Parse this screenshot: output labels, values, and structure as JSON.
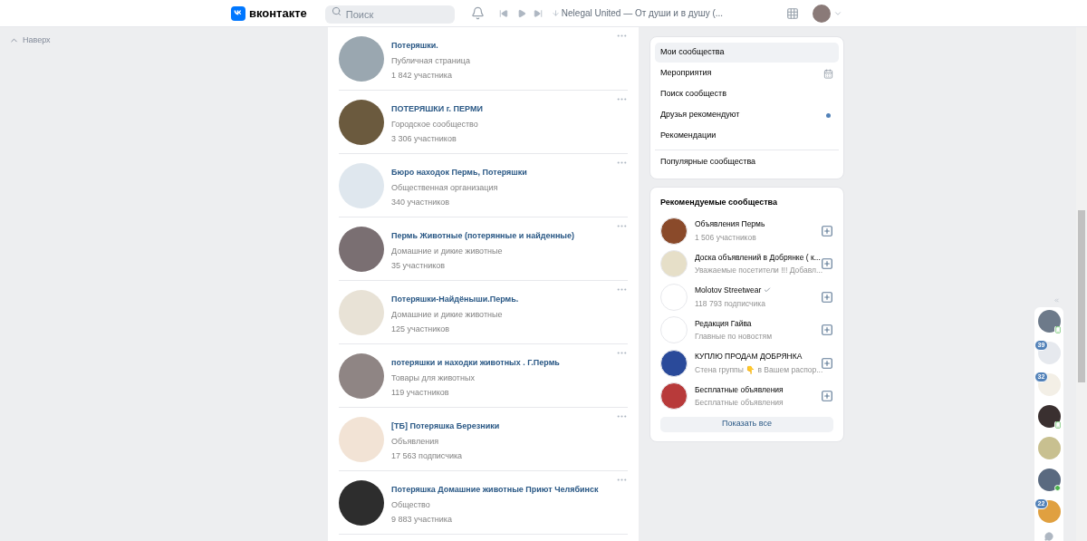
{
  "header": {
    "logo": "вконтакте",
    "search": {
      "placeholder": "Поиск"
    },
    "track": "Nelegal United — От души и в душу (..."
  },
  "back_to_top": "Наверх",
  "groups": [
    {
      "name": "Потеряшки.",
      "type": "Публичная страница",
      "members": "1 842 участника"
    },
    {
      "name": "ПОТЕРЯШКИ г. ПЕРМИ",
      "type": "Городское сообщество",
      "members": "3 306 участников"
    },
    {
      "name": "Бюро находок Пермь, Потеряшки",
      "type": "Общественная организация",
      "members": "340 участников"
    },
    {
      "name": "Пермь Животные (потерянные и найденные)",
      "type": "Домашние и дикие животные",
      "members": "35 участников"
    },
    {
      "name": "Потеряшки-Найдёныши.Пермь.",
      "type": "Домашние и дикие животные",
      "members": "125 участников"
    },
    {
      "name": "потеряшки и находки животных . Г.Пермь",
      "type": "Товары для животных",
      "members": "119 участников"
    },
    {
      "name": "[ТБ] Потеряшка Березники",
      "type": "Объявления",
      "members": "17 563 подписчика"
    },
    {
      "name": "Потеряшка Домашние животные Приют Челябинск",
      "type": "Общество",
      "members": "9 883 участника"
    }
  ],
  "menu": [
    {
      "label": "Мои сообщества",
      "selected": true,
      "kind": "plain",
      "unread": false,
      "divider_before": false
    },
    {
      "label": "Мероприятия",
      "selected": false,
      "kind": "calendar",
      "unread": false,
      "divider_before": false
    },
    {
      "label": "Поиск сообществ",
      "selected": false,
      "kind": "plain",
      "unread": false,
      "divider_before": false
    },
    {
      "label": "Друзья рекомендуют",
      "selected": false,
      "kind": "plain",
      "unread": true,
      "divider_before": false
    },
    {
      "label": "Рекомендации",
      "selected": false,
      "kind": "plain",
      "unread": false,
      "divider_before": false
    },
    {
      "label": "Популярные сообщества",
      "selected": false,
      "kind": "plain",
      "unread": false,
      "divider_before": true
    }
  ],
  "recommended": {
    "title": "Рекомендуемые сообщества",
    "show_all": "Показать все",
    "items": [
      {
        "name": "Объявления Пермь",
        "subtitle": "1 506 участников",
        "verified": false
      },
      {
        "name": "Доска объявлений в Добрянке ( к...",
        "subtitle": "Уважаемые посетители !!! Добавл...",
        "verified": false
      },
      {
        "name": "Molotov Streetwear",
        "subtitle": "118 793 подписчика",
        "verified": true
      },
      {
        "name": "Редакция Гайва",
        "subtitle": "Главные по новостям",
        "verified": false
      },
      {
        "name": "КУПЛЮ ПРОДАМ ДОБРЯНКА",
        "subtitle": "Стена группы 👇 в Вашем распор...",
        "verified": false
      },
      {
        "name": "Бесплатные объявления",
        "subtitle": "Бесплатные объявления",
        "verified": false
      }
    ]
  },
  "chats": [
    {
      "online_web": false,
      "online_mobile": true
    },
    {
      "badge": "39",
      "online_web": false,
      "online_mobile": false
    },
    {
      "badge": "32",
      "online_web": false,
      "online_mobile": false
    },
    {
      "online_web": false,
      "online_mobile": true
    },
    {
      "online_web": false,
      "online_mobile": false
    },
    {
      "online_web": true,
      "online_mobile": false
    },
    {
      "badge": "22",
      "online_web": false,
      "online_mobile": false
    }
  ]
}
